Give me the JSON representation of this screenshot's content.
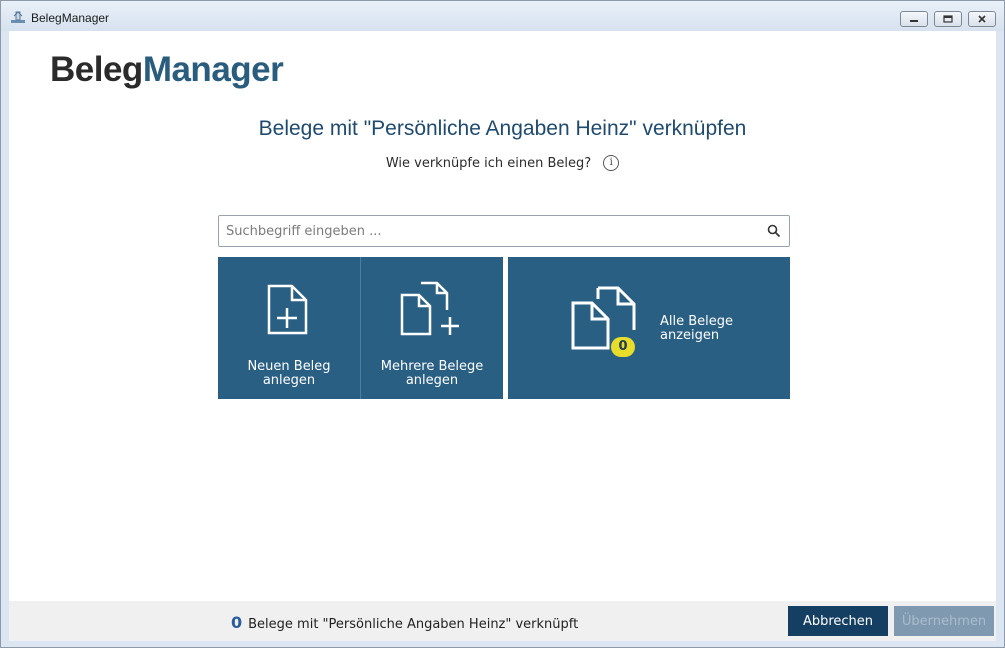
{
  "window": {
    "title": "BelegManager",
    "icon": "app-icon",
    "controls": [
      "minimize-icon",
      "maximize-icon",
      "close-icon"
    ]
  },
  "logo": {
    "part1": "Beleg",
    "part2": "Manager"
  },
  "heading": "Belege mit \"Persönliche Angaben Heinz\" verknüpfen",
  "help": {
    "text": "Wie verknüpfe ich einen Beleg?",
    "icon": "info-icon",
    "glyph": "i"
  },
  "search": {
    "placeholder": "Suchbegriff eingeben ...",
    "value": "",
    "icon": "search-icon"
  },
  "tiles": {
    "new": {
      "label": "Neuen Beleg\nanlegen",
      "icon": "document-add-icon"
    },
    "multi": {
      "label": "Mehrere Belege\nanlegen",
      "icon": "documents-add-icon"
    },
    "all": {
      "label": "Alle Belege\nanzeigen",
      "icon": "documents-icon",
      "badge": "0"
    }
  },
  "footer": {
    "count": "0",
    "status": "Belege mit \"Persönliche Angaben Heinz\" verknüpft",
    "cancel_label": "Abbrechen",
    "apply_label": "Übernehmen"
  },
  "colors": {
    "tile": "#2a5f84",
    "accent": "#2a5c7d",
    "badge": "#e8dd2a",
    "primary_button": "#153f62",
    "disabled_button": "#7f9ab0"
  }
}
